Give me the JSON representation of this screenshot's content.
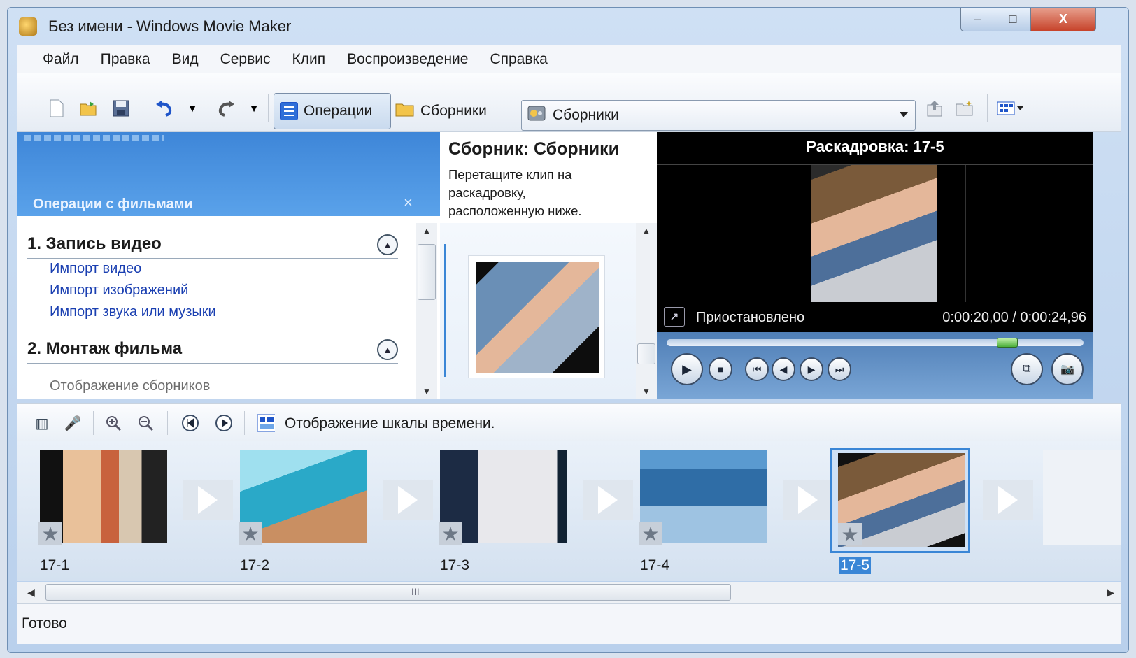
{
  "window": {
    "title": "Без имени - Windows Movie Maker",
    "controls": {
      "minimize": "–",
      "maximize": "□",
      "close": "X"
    }
  },
  "menu": [
    "Файл",
    "Правка",
    "Вид",
    "Сервис",
    "Клип",
    "Воспроизведение",
    "Справка"
  ],
  "toolbar": {
    "operations_label": "Операции",
    "collections_label": "Сборники",
    "combo_value": "Сборники"
  },
  "tasks": {
    "header": "Операции с фильмами",
    "close": "×",
    "section1": {
      "title": "1. Запись видео",
      "links": [
        "Импорт видео",
        "Импорт изображений",
        "Импорт звука или музыки"
      ]
    },
    "section2": {
      "title": "2. Монтаж фильма",
      "items": [
        "Отображение сборников"
      ]
    }
  },
  "collection": {
    "title": "Сборник: Сборники",
    "description": "Перетащите клип на раскадровку, расположенную ниже."
  },
  "preview": {
    "title": "Раскадровка: 17-5",
    "status": "Приостановлено",
    "time": "0:00:20,00 / 0:00:24,96"
  },
  "storyboard": {
    "toggle_label": "Отображение шкалы времени.",
    "clips": [
      {
        "label": "17-1"
      },
      {
        "label": "17-2"
      },
      {
        "label": "17-3"
      },
      {
        "label": "17-4"
      },
      {
        "label": "17-5"
      }
    ],
    "selected_clip": "17-5"
  },
  "statusbar": {
    "text": "Готово"
  },
  "colors": {
    "accent": "#3a86d6",
    "link": "#1a3fb1"
  }
}
